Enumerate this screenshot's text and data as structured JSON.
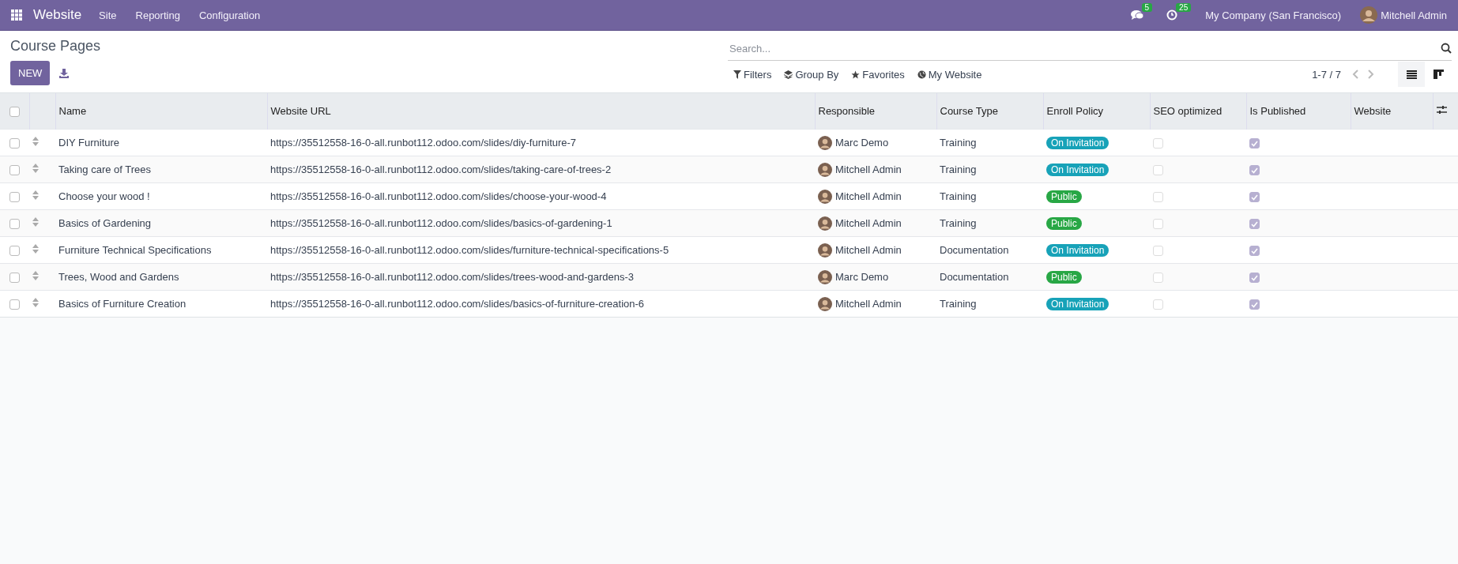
{
  "navbar": {
    "app_name": "Website",
    "menu": [
      "Site",
      "Reporting",
      "Configuration"
    ],
    "messages_badge": "5",
    "activities_badge": "25",
    "company": "My Company (San Francisco)",
    "user": "Mitchell Admin"
  },
  "control_panel": {
    "title": "Course Pages",
    "new_button": "NEW",
    "search": {
      "placeholder": "Search..."
    },
    "filters": [
      {
        "kind": "filter",
        "label": "Filters"
      },
      {
        "kind": "groupby",
        "label": "Group By"
      },
      {
        "kind": "favorites",
        "label": "Favorites"
      },
      {
        "kind": "website",
        "label": "My Website"
      }
    ],
    "pager": "1-7 / 7",
    "views": [
      {
        "kind": "list",
        "selected": true
      },
      {
        "kind": "kanban",
        "selected": false
      }
    ]
  },
  "table": {
    "all_selected": false,
    "columns": [
      "Name",
      "Website URL",
      "Responsible",
      "Course Type",
      "Enroll Policy",
      "SEO optimized",
      "Is Published",
      "Website"
    ],
    "rows": [
      {
        "selected": false,
        "name": "DIY Furniture",
        "url": "https://35512558-16-0-all.runbot112.odoo.com/slides/diy-furniture-7",
        "responsible": "Marc Demo",
        "course_type": "Training",
        "enroll_policy": {
          "label": "On Invitation",
          "color": "#17a2b8"
        },
        "seo_optimized": false,
        "is_published": true
      },
      {
        "selected": false,
        "name": "Taking care of Trees",
        "url": "https://35512558-16-0-all.runbot112.odoo.com/slides/taking-care-of-trees-2",
        "responsible": "Mitchell Admin",
        "course_type": "Training",
        "enroll_policy": {
          "label": "On Invitation",
          "color": "#17a2b8"
        },
        "seo_optimized": false,
        "is_published": true
      },
      {
        "selected": false,
        "name": "Choose your wood !",
        "url": "https://35512558-16-0-all.runbot112.odoo.com/slides/choose-your-wood-4",
        "responsible": "Mitchell Admin",
        "course_type": "Training",
        "enroll_policy": {
          "label": "Public",
          "color": "#28a745"
        },
        "seo_optimized": false,
        "is_published": true
      },
      {
        "selected": false,
        "name": "Basics of Gardening",
        "url": "https://35512558-16-0-all.runbot112.odoo.com/slides/basics-of-gardening-1",
        "responsible": "Mitchell Admin",
        "course_type": "Training",
        "enroll_policy": {
          "label": "Public",
          "color": "#28a745"
        },
        "seo_optimized": false,
        "is_published": true
      },
      {
        "selected": false,
        "name": "Furniture Technical Specifications",
        "url": "https://35512558-16-0-all.runbot112.odoo.com/slides/furniture-technical-specifications-5",
        "responsible": "Mitchell Admin",
        "course_type": "Documentation",
        "enroll_policy": {
          "label": "On Invitation",
          "color": "#17a2b8"
        },
        "seo_optimized": false,
        "is_published": true
      },
      {
        "selected": false,
        "name": "Trees, Wood and Gardens",
        "url": "https://35512558-16-0-all.runbot112.odoo.com/slides/trees-wood-and-gardens-3",
        "responsible": "Marc Demo",
        "course_type": "Documentation",
        "enroll_policy": {
          "label": "Public",
          "color": "#28a745"
        },
        "seo_optimized": false,
        "is_published": true
      },
      {
        "selected": false,
        "name": "Basics of Furniture Creation",
        "url": "https://35512558-16-0-all.runbot112.odoo.com/slides/basics-of-furniture-creation-6",
        "responsible": "Mitchell Admin",
        "course_type": "Training",
        "enroll_policy": {
          "label": "On Invitation",
          "color": "#17a2b8"
        },
        "seo_optimized": false,
        "is_published": true
      }
    ]
  }
}
